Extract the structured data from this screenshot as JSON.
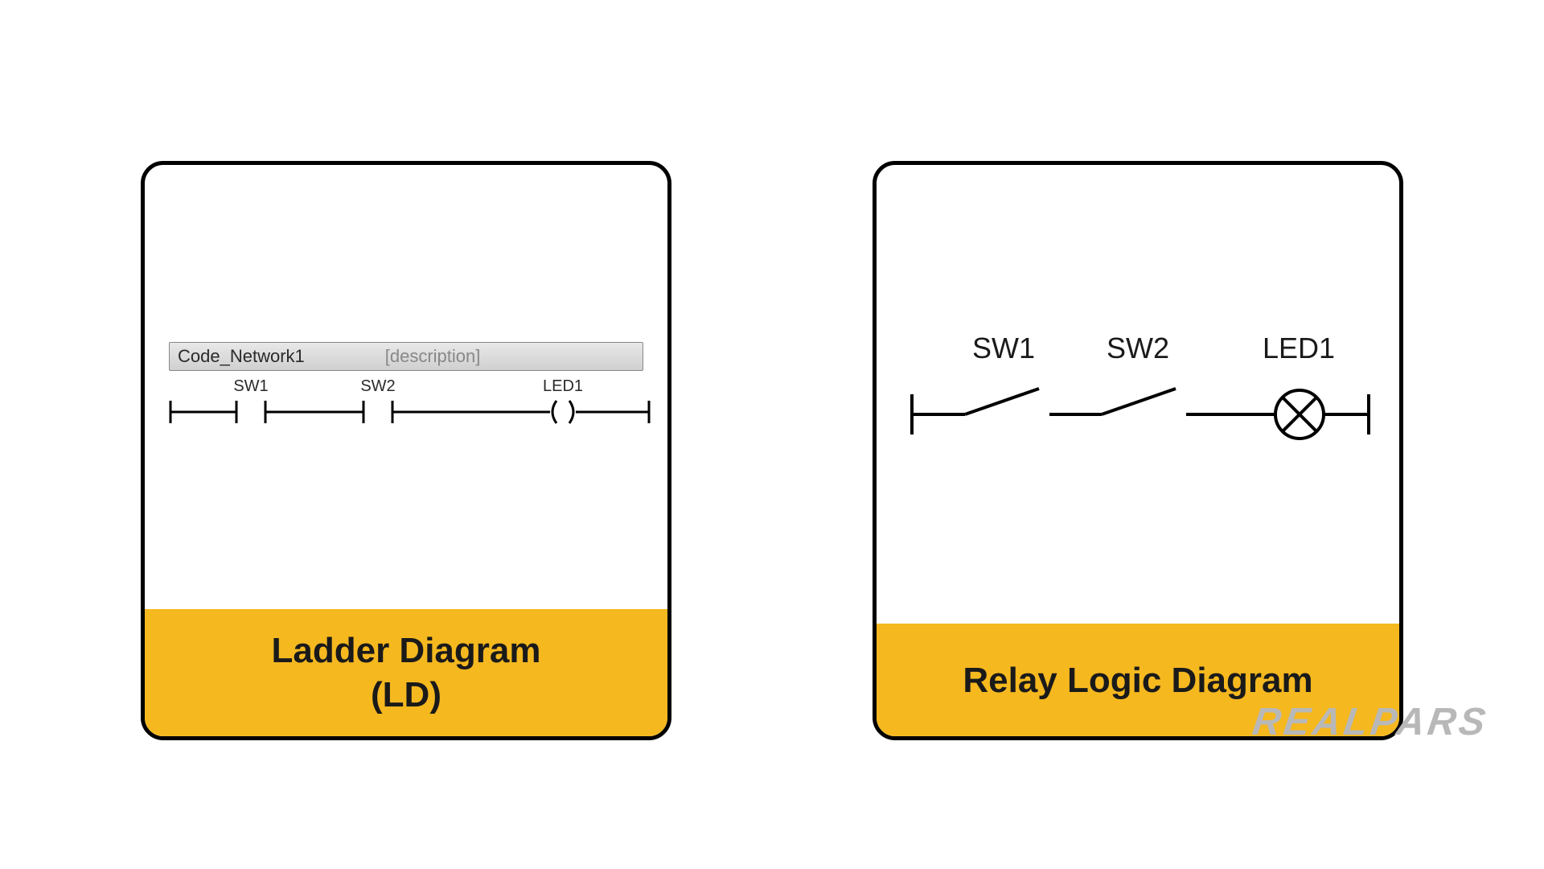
{
  "left_panel": {
    "title_line1": "Ladder Diagram",
    "title_line2": "(LD)",
    "network_name": "Code_Network1",
    "network_desc": "[description]",
    "elements": {
      "sw1": "SW1",
      "sw2": "SW2",
      "led1": "LED1"
    }
  },
  "right_panel": {
    "title": "Relay Logic Diagram",
    "elements": {
      "sw1": "SW1",
      "sw2": "SW2",
      "led1": "LED1"
    }
  },
  "brand": "REALPARS"
}
